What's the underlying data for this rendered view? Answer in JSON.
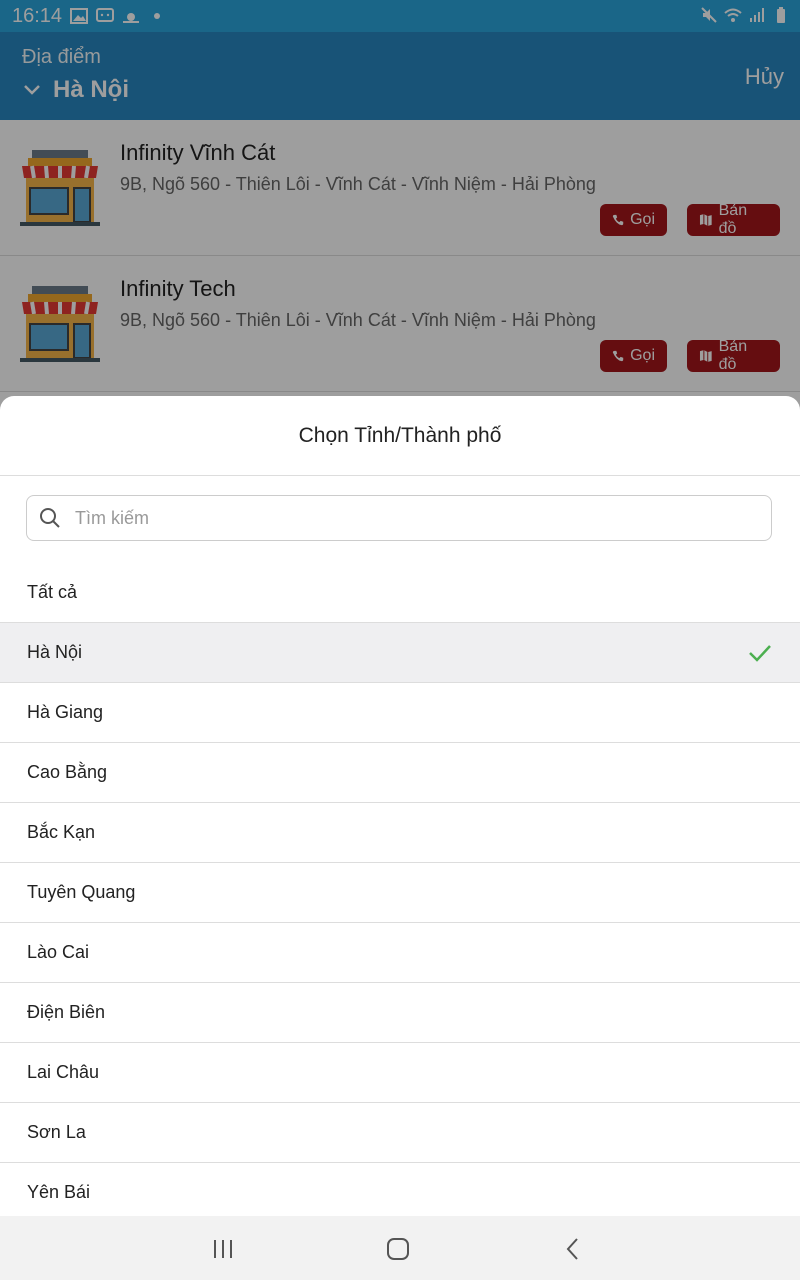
{
  "status_bar": {
    "time": "16:14"
  },
  "header": {
    "label": "Địa điểm",
    "city": "Hà Nội",
    "cancel": "Hủy"
  },
  "stores": [
    {
      "name": "Infinity Vĩnh Cát",
      "address": "9B, Ngõ 560 - Thiên Lôi - Vĩnh Cát - Vĩnh Niệm - Hải Phòng",
      "call_label": "Gọi",
      "map_label": "Bản đồ"
    },
    {
      "name": "Infinity Tech",
      "address": "9B, Ngõ 560 - Thiên Lôi - Vĩnh Cát - Vĩnh Niệm - Hải Phòng",
      "call_label": "Gọi",
      "map_label": "Bản đồ"
    }
  ],
  "sheet": {
    "title": "Chọn Tỉnh/Thành phố",
    "search_placeholder": "Tìm kiếm",
    "provinces": [
      "Tất cả",
      "Hà Nội",
      "Hà Giang",
      "Cao Bằng",
      "Bắc Kạn",
      "Tuyên Quang",
      "Lào Cai",
      "Điện Biên",
      "Lai Châu",
      "Sơn La",
      "Yên Bái"
    ],
    "selected": "Hà Nội"
  },
  "colors": {
    "status_bar": "#2aa5dc",
    "header": "#2787c0",
    "button": "#a3161b",
    "check": "#4caf50"
  }
}
